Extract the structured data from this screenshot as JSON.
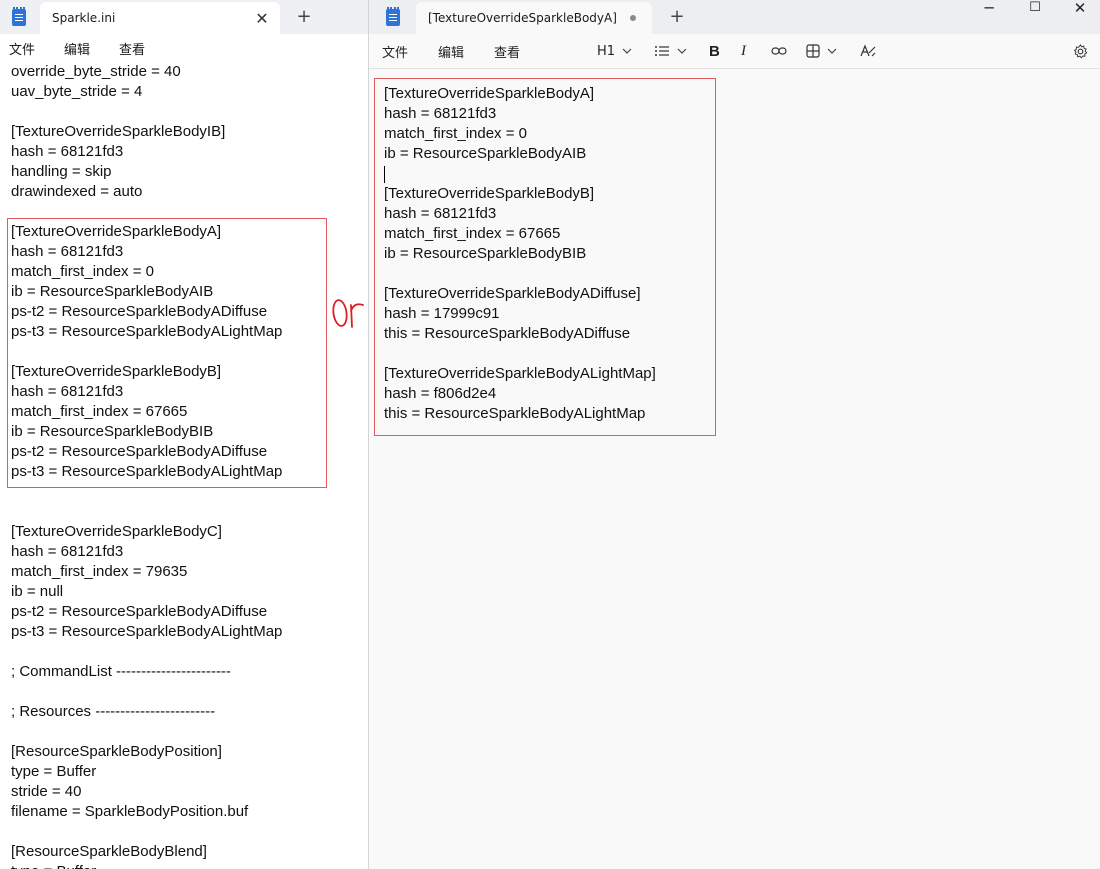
{
  "left_window": {
    "tab_title": "Sparkle.ini",
    "menu": [
      "文件",
      "编辑",
      "查看"
    ],
    "lines": [
      "override_byte_stride = 40",
      "uav_byte_stride = 4",
      "",
      "[TextureOverrideSparkleBodyIB]",
      "hash = 68121fd3",
      "handling = skip",
      "drawindexed = auto",
      "",
      "[TextureOverrideSparkleBodyA]",
      "hash = 68121fd3",
      "match_first_index = 0",
      "ib = ResourceSparkleBodyAIB",
      "ps-t2 = ResourceSparkleBodyADiffuse",
      "ps-t3 = ResourceSparkleBodyALightMap",
      "",
      "[TextureOverrideSparkleBodyB]",
      "hash = 68121fd3",
      "match_first_index = 67665",
      "ib = ResourceSparkleBodyBIB",
      "ps-t2 = ResourceSparkleBodyADiffuse",
      "ps-t3 = ResourceSparkleBodyALightMap",
      "",
      "",
      "[TextureOverrideSparkleBodyC]",
      "hash = 68121fd3",
      "match_first_index = 79635",
      "ib = null",
      "ps-t2 = ResourceSparkleBodyADiffuse",
      "ps-t3 = ResourceSparkleBodyALightMap",
      "",
      "; CommandList -----------------------",
      "",
      "; Resources ------------------------",
      "",
      "[ResourceSparkleBodyPosition]",
      "type = Buffer",
      "stride = 40",
      "filename = SparkleBodyPosition.buf",
      "",
      "[ResourceSparkleBodyBlend]",
      "type = Buffer"
    ]
  },
  "right_window": {
    "tab_title": "[TextureOverrideSparkleBodyA]",
    "menu": [
      "文件",
      "编辑",
      "查看"
    ],
    "heading_label": "H1",
    "lines_before_caret": [
      "[TextureOverrideSparkleBodyA]",
      "hash = 68121fd3",
      "match_first_index = 0",
      "ib = ResourceSparkleBodyAIB"
    ],
    "lines_after_caret": [
      "[TextureOverrideSparkleBodyB]",
      "hash = 68121fd3",
      "match_first_index = 67665",
      "ib = ResourceSparkleBodyBIB",
      "",
      "[TextureOverrideSparkleBodyADiffuse]",
      "hash = 17999c91",
      "this = ResourceSparkleBodyADiffuse",
      "",
      "[TextureOverrideSparkleBodyALightMap]",
      "hash = f806d2e4",
      "this = ResourceSparkleBodyALightMap"
    ]
  },
  "annotation": {
    "text": "or",
    "color": "#e02020"
  },
  "colors": {
    "highlight_box": "#e05a60",
    "app_icon": "#2f73d6"
  }
}
